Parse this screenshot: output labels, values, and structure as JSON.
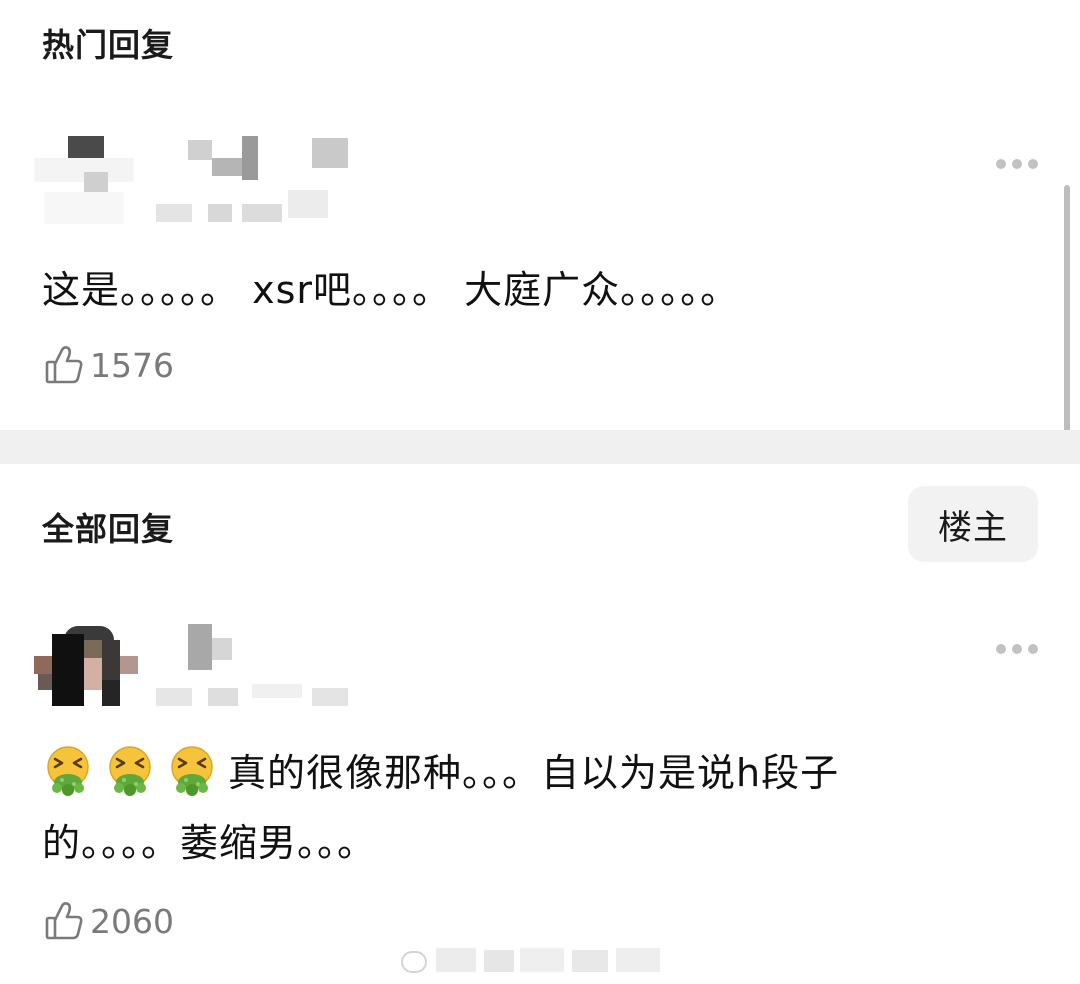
{
  "hot_replies": {
    "title": "热门回复",
    "comment": {
      "text": "这是。。。。。 xsr吧。。。。 大庭广众。。。。。",
      "likes": "1576"
    }
  },
  "all_replies": {
    "title": "全部回复",
    "owner_button": "楼主",
    "comment": {
      "reaction_emojis": [
        "nauseated-face-emoji",
        "nauseated-face-emoji",
        "nauseated-face-emoji"
      ],
      "text": "真的很像那种。。。自以为是说h段子的。。。。萎缩男。。。",
      "likes": "2060"
    }
  },
  "icons": {
    "more": "more-dots-icon",
    "like": "thumbs-up-icon"
  },
  "colors": {
    "divider": "#f0f0f0",
    "muted_text": "#7a7a7a",
    "button_bg": "#f2f2f2"
  }
}
